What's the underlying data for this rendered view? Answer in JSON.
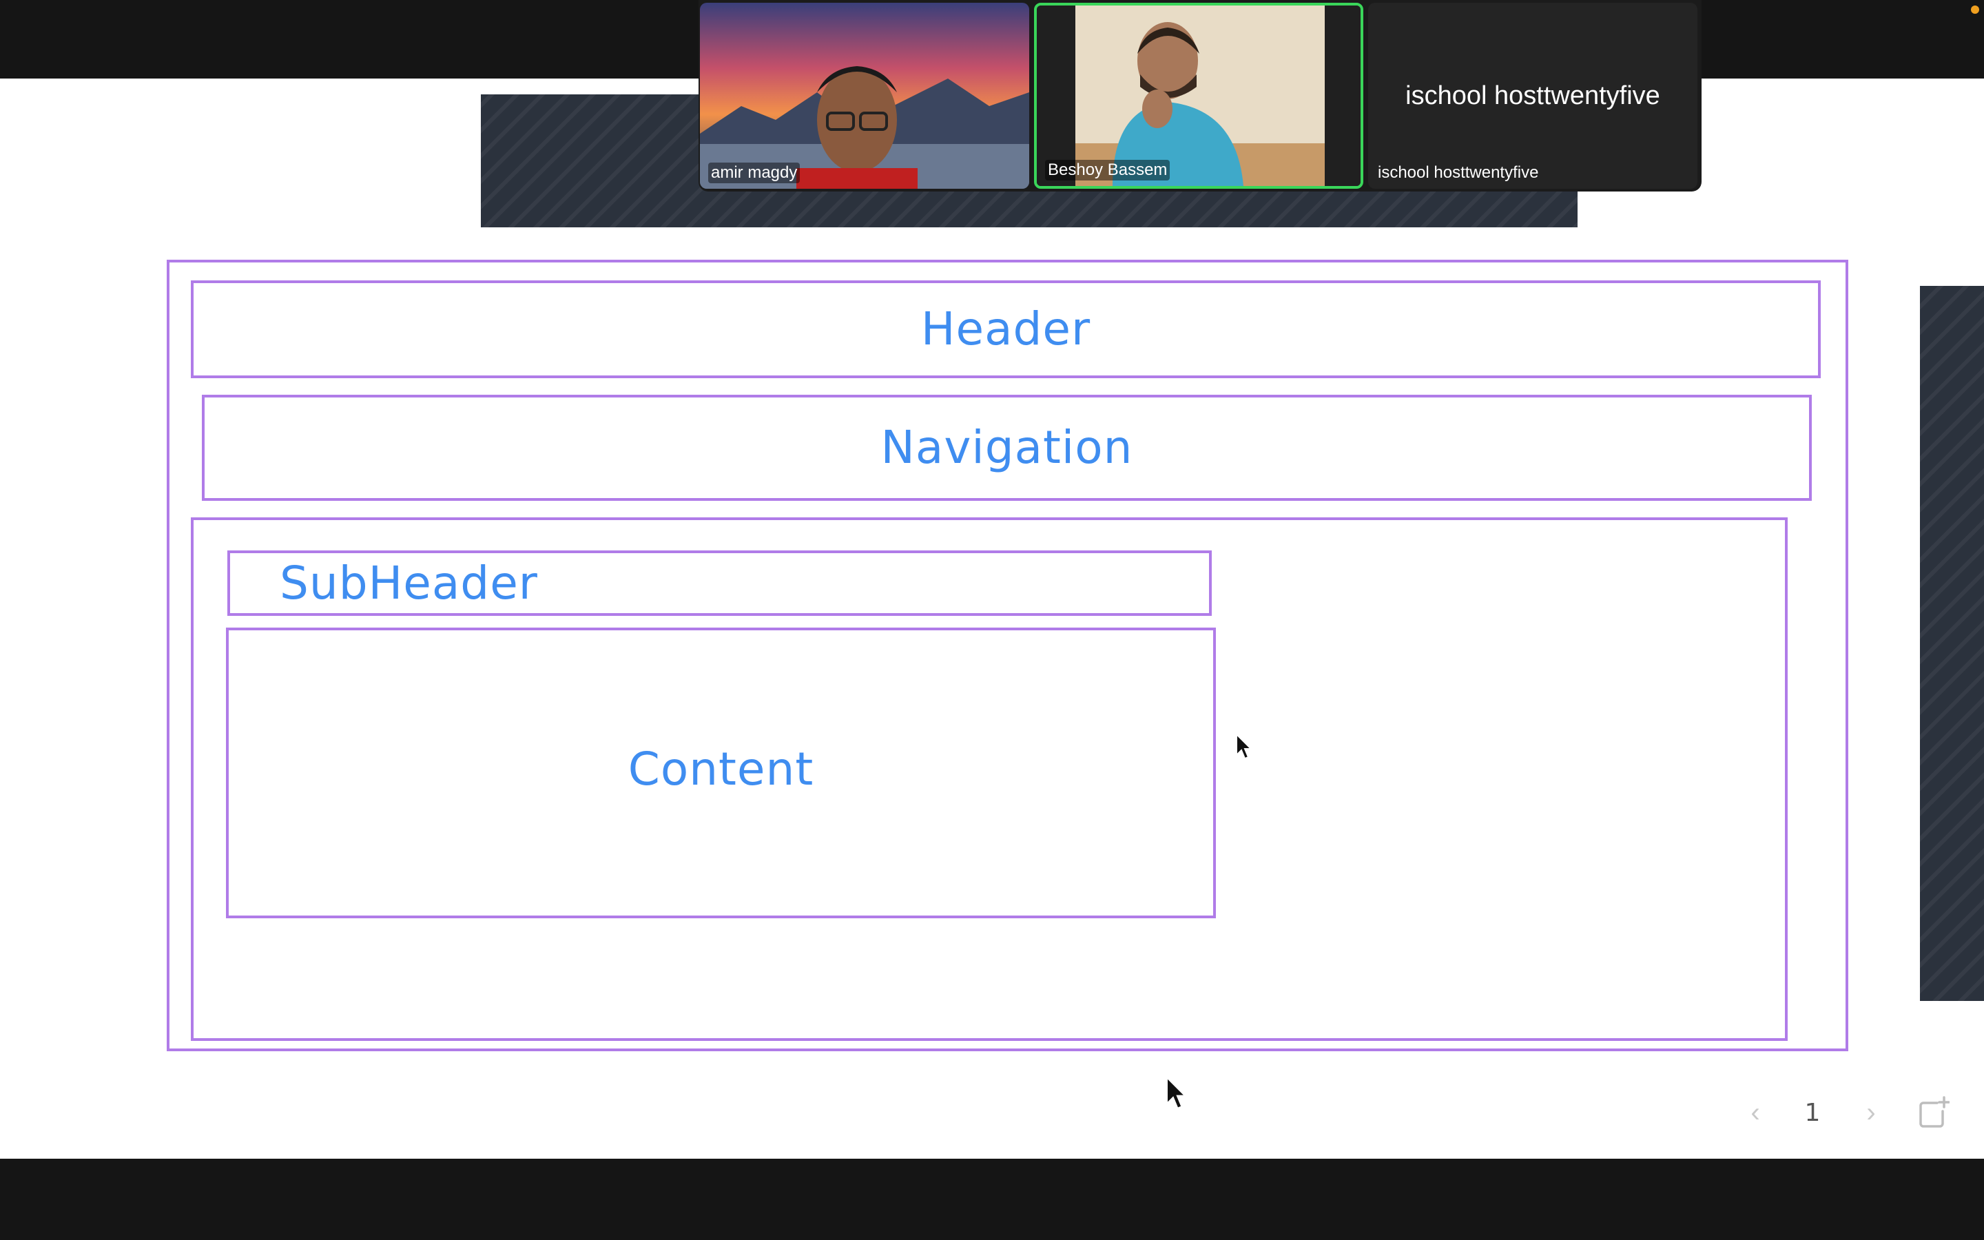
{
  "slide": {
    "header_label": "Header",
    "navigation_label": "Navigation",
    "subheader_label": "SubHeader",
    "content_label": "Content",
    "box_border_color": "#b07ce8",
    "label_color": "#3f8df0"
  },
  "pager": {
    "prev_icon": "‹",
    "page_number": "1",
    "next_icon": "›"
  },
  "participants": [
    {
      "name": "amir magdy"
    },
    {
      "name": "Beshoy Bassem",
      "active_speaker": true,
      "highlight_color": "#3ad65a"
    },
    {
      "name": "ischool hosttwentyfive",
      "display_name": "ischool hosttwentyfive"
    }
  ]
}
